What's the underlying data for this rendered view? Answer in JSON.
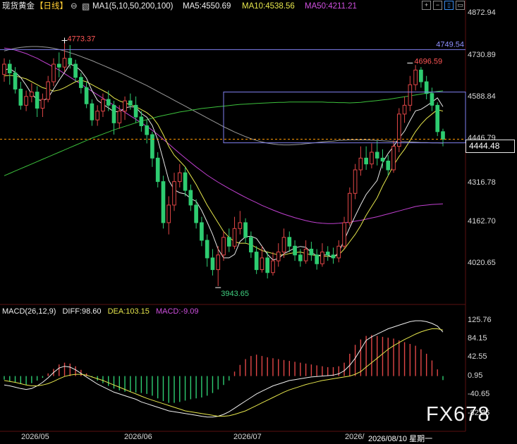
{
  "header": {
    "instrument": "现货黄金",
    "period": "【日线】",
    "indicator": "MA1(5,10,50,200,100)",
    "ma5": "MA5:4550.69",
    "ma10": "MA10:4538.56",
    "ma50": "MA50:4211.21"
  },
  "toolbar_icons": [
    "plus-icon",
    "minus-icon",
    "expand-icon",
    "collapse-icon"
  ],
  "price_axis": [
    "4872.94",
    "4730.89",
    "4588.84",
    "4446.79",
    "4316.78",
    "4162.70",
    "4020.65"
  ],
  "current_price": "4444.48",
  "annotations": {
    "high_label": "4773.37",
    "recent_high_label": "4696.59",
    "low_label": "3943.65",
    "resistance_label": "4749.54"
  },
  "macd_header": {
    "title": "MACD(26,12,9)",
    "diff": "DIFF:98.60",
    "dea": "DEA:103.15",
    "macd": "MACD:-9.09"
  },
  "macd_axis": [
    "125.76",
    "84.15",
    "42.55",
    "0.95",
    "-40.65",
    "-82.26"
  ],
  "date_axis": [
    "2026/05",
    "2026/06",
    "2026/07",
    "2026/",
    "2026/08/10 星期一"
  ],
  "watermark": "FX678",
  "colors": {
    "up": "#e04646",
    "down": "#2ecc71",
    "ma5": "#e8e8e8",
    "ma10": "#e6e64c",
    "ma50": "#c040d0",
    "ma100": "#9a9a9a",
    "ma200": "#3cc03c",
    "box": "#8080f0",
    "dash": "#ff9900"
  },
  "chart_data": {
    "type": "candlestick",
    "ylim": [
      3900,
      4900
    ],
    "macd_ylim": [
      -100,
      135
    ],
    "candles": [
      {
        "o": 4665,
        "c": 4700,
        "h": 4720,
        "l": 4640
      },
      {
        "o": 4700,
        "c": 4670,
        "h": 4715,
        "l": 4630
      },
      {
        "o": 4670,
        "c": 4615,
        "h": 4690,
        "l": 4600
      },
      {
        "o": 4615,
        "c": 4560,
        "h": 4640,
        "l": 4545
      },
      {
        "o": 4560,
        "c": 4590,
        "h": 4610,
        "l": 4540
      },
      {
        "o": 4590,
        "c": 4605,
        "h": 4635,
        "l": 4570
      },
      {
        "o": 4605,
        "c": 4550,
        "h": 4625,
        "l": 4520
      },
      {
        "o": 4550,
        "c": 4580,
        "h": 4600,
        "l": 4520
      },
      {
        "o": 4580,
        "c": 4640,
        "h": 4660,
        "l": 4570
      },
      {
        "o": 4640,
        "c": 4700,
        "h": 4720,
        "l": 4625
      },
      {
        "o": 4700,
        "c": 4690,
        "h": 4740,
        "l": 4655
      },
      {
        "o": 4690,
        "c": 4720,
        "h": 4773,
        "l": 4675
      },
      {
        "o": 4720,
        "c": 4700,
        "h": 4765,
        "l": 4685
      },
      {
        "o": 4700,
        "c": 4655,
        "h": 4715,
        "l": 4640
      },
      {
        "o": 4655,
        "c": 4620,
        "h": 4670,
        "l": 4600
      },
      {
        "o": 4620,
        "c": 4565,
        "h": 4640,
        "l": 4550
      },
      {
        "o": 4565,
        "c": 4510,
        "h": 4580,
        "l": 4490
      },
      {
        "o": 4510,
        "c": 4540,
        "h": 4560,
        "l": 4490
      },
      {
        "o": 4540,
        "c": 4580,
        "h": 4600,
        "l": 4520
      },
      {
        "o": 4580,
        "c": 4560,
        "h": 4610,
        "l": 4540
      },
      {
        "o": 4560,
        "c": 4500,
        "h": 4575,
        "l": 4460
      },
      {
        "o": 4500,
        "c": 4540,
        "h": 4560,
        "l": 4480
      },
      {
        "o": 4540,
        "c": 4575,
        "h": 4590,
        "l": 4510
      },
      {
        "o": 4575,
        "c": 4560,
        "h": 4600,
        "l": 4545
      },
      {
        "o": 4560,
        "c": 4520,
        "h": 4590,
        "l": 4500
      },
      {
        "o": 4520,
        "c": 4490,
        "h": 4540,
        "l": 4470
      },
      {
        "o": 4490,
        "c": 4460,
        "h": 4510,
        "l": 4430
      },
      {
        "o": 4460,
        "c": 4380,
        "h": 4470,
        "l": 4350
      },
      {
        "o": 4380,
        "c": 4300,
        "h": 4400,
        "l": 4280
      },
      {
        "o": 4300,
        "c": 4160,
        "h": 4320,
        "l": 4140
      },
      {
        "o": 4160,
        "c": 4220,
        "h": 4250,
        "l": 4120
      },
      {
        "o": 4220,
        "c": 4300,
        "h": 4330,
        "l": 4200
      },
      {
        "o": 4300,
        "c": 4330,
        "h": 4360,
        "l": 4280
      },
      {
        "o": 4330,
        "c": 4270,
        "h": 4350,
        "l": 4250
      },
      {
        "o": 4270,
        "c": 4220,
        "h": 4290,
        "l": 4200
      },
      {
        "o": 4220,
        "c": 4160,
        "h": 4240,
        "l": 4140
      },
      {
        "o": 4160,
        "c": 4100,
        "h": 4180,
        "l": 4080
      },
      {
        "o": 4100,
        "c": 4040,
        "h": 4120,
        "l": 4010
      },
      {
        "o": 4040,
        "c": 4000,
        "h": 4070,
        "l": 3980
      },
      {
        "o": 4000,
        "c": 4050,
        "h": 4080,
        "l": 3944
      },
      {
        "o": 4050,
        "c": 4110,
        "h": 4130,
        "l": 4030
      },
      {
        "o": 4110,
        "c": 4080,
        "h": 4140,
        "l": 4060
      },
      {
        "o": 4080,
        "c": 4140,
        "h": 4180,
        "l": 4070
      },
      {
        "o": 4140,
        "c": 4160,
        "h": 4200,
        "l": 4120
      },
      {
        "o": 4160,
        "c": 4110,
        "h": 4175,
        "l": 4090
      },
      {
        "o": 4110,
        "c": 4060,
        "h": 4130,
        "l": 4040
      },
      {
        "o": 4060,
        "c": 4000,
        "h": 4080,
        "l": 3985
      },
      {
        "o": 4000,
        "c": 4040,
        "h": 4080,
        "l": 3990
      },
      {
        "o": 4040,
        "c": 3990,
        "h": 4060,
        "l": 3970
      },
      {
        "o": 3990,
        "c": 4030,
        "h": 4060,
        "l": 3980
      },
      {
        "o": 4030,
        "c": 4060,
        "h": 4090,
        "l": 4010
      },
      {
        "o": 4060,
        "c": 4110,
        "h": 4140,
        "l": 4040
      },
      {
        "o": 4110,
        "c": 4080,
        "h": 4130,
        "l": 4060
      },
      {
        "o": 4080,
        "c": 4050,
        "h": 4100,
        "l": 4030
      },
      {
        "o": 4050,
        "c": 4030,
        "h": 4070,
        "l": 4010
      },
      {
        "o": 4030,
        "c": 4070,
        "h": 4100,
        "l": 4020
      },
      {
        "o": 4070,
        "c": 4050,
        "h": 4095,
        "l": 4030
      },
      {
        "o": 4050,
        "c": 4020,
        "h": 4070,
        "l": 4000
      },
      {
        "o": 4020,
        "c": 4060,
        "h": 4090,
        "l": 4010
      },
      {
        "o": 4060,
        "c": 4050,
        "h": 4080,
        "l": 4030
      },
      {
        "o": 4050,
        "c": 4040,
        "h": 4075,
        "l": 4020
      },
      {
        "o": 4040,
        "c": 4080,
        "h": 4100,
        "l": 4025
      },
      {
        "o": 4080,
        "c": 4160,
        "h": 4180,
        "l": 4070
      },
      {
        "o": 4160,
        "c": 4260,
        "h": 4280,
        "l": 4150
      },
      {
        "o": 4260,
        "c": 4340,
        "h": 4360,
        "l": 4240
      },
      {
        "o": 4340,
        "c": 4380,
        "h": 4420,
        "l": 4320
      },
      {
        "o": 4380,
        "c": 4360,
        "h": 4420,
        "l": 4340
      },
      {
        "o": 4360,
        "c": 4400,
        "h": 4430,
        "l": 4345
      },
      {
        "o": 4400,
        "c": 4380,
        "h": 4440,
        "l": 4355
      },
      {
        "o": 4380,
        "c": 4370,
        "h": 4410,
        "l": 4345
      },
      {
        "o": 4370,
        "c": 4340,
        "h": 4390,
        "l": 4320
      },
      {
        "o": 4340,
        "c": 4420,
        "h": 4440,
        "l": 4330
      },
      {
        "o": 4420,
        "c": 4530,
        "h": 4550,
        "l": 4400
      },
      {
        "o": 4530,
        "c": 4560,
        "h": 4590,
        "l": 4500
      },
      {
        "o": 4560,
        "c": 4630,
        "h": 4660,
        "l": 4540
      },
      {
        "o": 4630,
        "c": 4680,
        "h": 4697,
        "l": 4610
      },
      {
        "o": 4680,
        "c": 4640,
        "h": 4690,
        "l": 4620
      },
      {
        "o": 4640,
        "c": 4600,
        "h": 4660,
        "l": 4580
      },
      {
        "o": 4600,
        "c": 4560,
        "h": 4620,
        "l": 4540
      },
      {
        "o": 4560,
        "c": 4470,
        "h": 4570,
        "l": 4455
      },
      {
        "o": 4470,
        "c": 4444,
        "h": 4480,
        "l": 4420
      }
    ],
    "ma5": [
      4680,
      4685,
      4672,
      4655,
      4628,
      4598,
      4580,
      4575,
      4585,
      4615,
      4645,
      4672,
      4700,
      4693,
      4677,
      4652,
      4610,
      4577,
      4563,
      4551,
      4538,
      4538,
      4551,
      4555,
      4553,
      4532,
      4519,
      4491,
      4442,
      4374,
      4304,
      4272,
      4262,
      4258,
      4242,
      4233,
      4202,
      4162,
      4120,
      4070,
      4040,
      4040,
      4052,
      4096,
      4112,
      4114,
      4106,
      4080,
      4052,
      4033,
      4038,
      4054,
      4064,
      4074,
      4079,
      4076,
      4058,
      4048,
      4050,
      4050,
      4040,
      4059,
      4101,
      4143,
      4183,
      4221,
      4256,
      4280,
      4304,
      4365,
      4396,
      4420,
      4448,
      4472,
      4508,
      4541,
      4546,
      4558,
      4571,
      4585,
      4555
    ],
    "ma10": [
      4660,
      4662,
      4660,
      4655,
      4650,
      4640,
      4630,
      4620,
      4615,
      4608,
      4612,
      4620,
      4630,
      4640,
      4645,
      4640,
      4630,
      4620,
      4610,
      4600,
      4585,
      4575,
      4568,
      4562,
      4555,
      4545,
      4535,
      4520,
      4495,
      4460,
      4420,
      4390,
      4370,
      4350,
      4320,
      4290,
      4255,
      4220,
      4190,
      4160,
      4130,
      4110,
      4095,
      4090,
      4090,
      4085,
      4075,
      4065,
      4060,
      4055,
      4050,
      4050,
      4055,
      4058,
      4060,
      4055,
      4050,
      4048,
      4046,
      4045,
      4045,
      4050,
      4070,
      4095,
      4120,
      4150,
      4185,
      4215,
      4245,
      4285,
      4320,
      4355,
      4385,
      4410,
      4440,
      4470,
      4495,
      4515,
      4530,
      4545,
      4540
    ],
    "ma50": [
      4755,
      4752,
      4748,
      4742,
      4736,
      4728,
      4720,
      4710,
      4700,
      4690,
      4680,
      4668,
      4656,
      4644,
      4632,
      4620,
      4608,
      4596,
      4584,
      4572,
      4560,
      4548,
      4536,
      4524,
      4512,
      4500,
      4488,
      4475,
      4460,
      4444,
      4428,
      4412,
      4396,
      4380,
      4365,
      4350,
      4336,
      4322,
      4310,
      4298,
      4287,
      4276,
      4266,
      4256,
      4246,
      4237,
      4228,
      4219,
      4211,
      4203,
      4196,
      4189,
      4183,
      4177,
      4172,
      4167,
      4163,
      4160,
      4158,
      4157,
      4157,
      4158,
      4160,
      4162,
      4165,
      4168,
      4172,
      4176,
      4180,
      4185,
      4190,
      4195,
      4200,
      4205,
      4210,
      4215,
      4218,
      4220,
      4222,
      4223,
      4224
    ],
    "ma100": [
      4745,
      4750,
      4754,
      4757,
      4759,
      4760,
      4760,
      4759,
      4757,
      4754,
      4750,
      4745,
      4739,
      4733,
      4726,
      4719,
      4712,
      4704,
      4696,
      4688,
      4680,
      4672,
      4663,
      4654,
      4645,
      4636,
      4627,
      4617,
      4607,
      4597,
      4587,
      4577,
      4567,
      4557,
      4547,
      4537,
      4527,
      4517,
      4507,
      4497,
      4487,
      4478,
      4469,
      4461,
      4453,
      4446,
      4440,
      4435,
      4431,
      4428,
      4426,
      4425,
      4425,
      4426,
      4427,
      4429,
      4431,
      4433,
      4435,
      4437,
      4438,
      4440,
      4441,
      4442,
      4442,
      4442,
      4442,
      4441,
      4440,
      4439,
      4438,
      4437,
      4436,
      4436,
      4435,
      4434,
      4433,
      4433,
      4432,
      4432,
      4431
    ],
    "ma200": [
      4320,
      4328,
      4336,
      4344,
      4352,
      4360,
      4368,
      4376,
      4384,
      4392,
      4400,
      4408,
      4416,
      4424,
      4432,
      4440,
      4448,
      4455,
      4462,
      4469,
      4476,
      4482,
      4488,
      4494,
      4500,
      4506,
      4511,
      4516,
      4521,
      4525,
      4529,
      4533,
      4537,
      4540,
      4543,
      4546,
      4549,
      4551,
      4553,
      4555,
      4557,
      4559,
      4561,
      4563,
      4564,
      4565,
      4566,
      4567,
      4568,
      4569,
      4570,
      4570,
      4571,
      4571,
      4571,
      4571,
      4571,
      4571,
      4571,
      4570,
      4570,
      4569,
      4569,
      4568,
      4569,
      4570,
      4572,
      4574,
      4576,
      4578,
      4580,
      4583,
      4586,
      4589,
      4592,
      4595,
      4598,
      4601,
      4604,
      4607,
      4609
    ],
    "macd_hist": [
      -8,
      -12,
      -15,
      -18,
      -20,
      -16,
      -10,
      -4,
      6,
      16,
      26,
      30,
      28,
      22,
      14,
      6,
      -2,
      -10,
      -16,
      -22,
      -28,
      -32,
      -35,
      -36,
      -37,
      -38,
      -40,
      -44,
      -50,
      -56,
      -60,
      -60,
      -58,
      -55,
      -52,
      -50,
      -48,
      -44,
      -38,
      -30,
      -20,
      -10,
      10,
      25,
      38,
      45,
      48,
      45,
      42,
      40,
      38,
      36,
      34,
      32,
      30,
      28,
      26,
      24,
      22,
      20,
      20,
      22,
      30,
      50,
      70,
      82,
      90,
      92,
      90,
      88,
      86,
      84,
      80,
      76,
      72,
      68,
      60,
      50,
      35,
      15,
      -9
    ],
    "diff": [
      -20,
      -22,
      -25,
      -28,
      -30,
      -28,
      -22,
      -14,
      -4,
      8,
      18,
      22,
      20,
      14,
      6,
      -2,
      -10,
      -18,
      -24,
      -30,
      -36,
      -40,
      -44,
      -48,
      -52,
      -58,
      -62,
      -66,
      -70,
      -74,
      -78,
      -80,
      -82,
      -84,
      -86,
      -88,
      -90,
      -92,
      -92,
      -90,
      -86,
      -80,
      -72,
      -64,
      -56,
      -48,
      -40,
      -34,
      -28,
      -22,
      -18,
      -14,
      -10,
      -8,
      -6,
      -4,
      -2,
      -1,
      0,
      1,
      2,
      5,
      12,
      24,
      40,
      60,
      80,
      88,
      94,
      100,
      106,
      110,
      114,
      118,
      122,
      124,
      124,
      122,
      118,
      112,
      98.6
    ],
    "dea": [
      -10,
      -12,
      -14,
      -17,
      -20,
      -22,
      -22,
      -20,
      -17,
      -12,
      -6,
      -1,
      2,
      4,
      4,
      2,
      -2,
      -6,
      -10,
      -15,
      -20,
      -25,
      -30,
      -35,
      -40,
      -45,
      -50,
      -54,
      -58,
      -62,
      -66,
      -70,
      -74,
      -78,
      -80,
      -82,
      -84,
      -86,
      -88,
      -90,
      -90,
      -89,
      -86,
      -82,
      -78,
      -72,
      -66,
      -60,
      -54,
      -48,
      -42,
      -36,
      -31,
      -27,
      -23,
      -19,
      -16,
      -13,
      -10,
      -8,
      -6,
      -4,
      -2,
      0,
      4,
      10,
      20,
      30,
      40,
      50,
      60,
      68,
      75,
      82,
      88,
      94,
      99,
      103,
      106,
      106,
      103.15
    ]
  }
}
